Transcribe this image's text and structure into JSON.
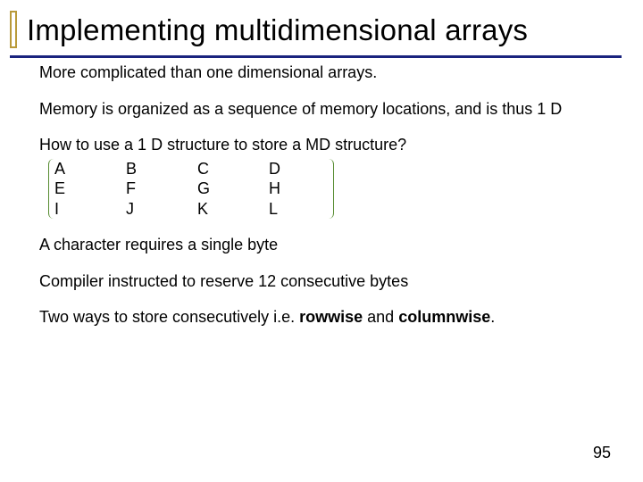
{
  "slide": {
    "title": "Implementing multidimensional arrays",
    "paras": {
      "p1": "More complicated than one dimensional arrays.",
      "p2": "Memory is organized as a sequence of memory locations, and is thus 1 D",
      "p3": "How to use a 1 D structure to store a MD structure?",
      "p4": "A character requires a single byte",
      "p5": "Compiler instructed to reserve 12 consecutive bytes",
      "p6a": "Two ways to store consecutively i.e. ",
      "rowwise": "rowwise",
      "and": " and ",
      "columnwise": "columnwise",
      "dot": "."
    },
    "grid": {
      "r0": {
        "c0": "A",
        "c1": "B",
        "c2": "C",
        "c3": "D"
      },
      "r1": {
        "c0": "E",
        "c1": "F",
        "c2": "G",
        "c3": "H"
      },
      "r2": {
        "c0": "I",
        "c1": "J",
        "c2": "K",
        "c3": "L"
      }
    },
    "pagenum": "95"
  }
}
